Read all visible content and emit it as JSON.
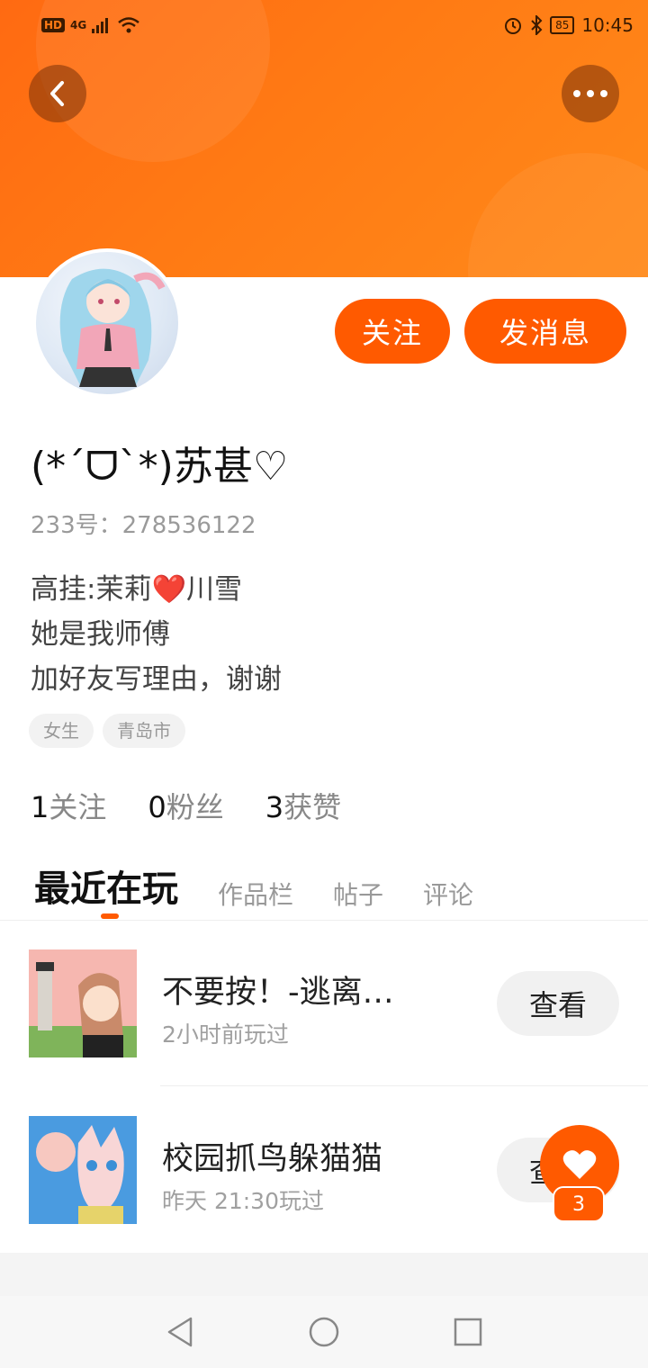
{
  "status_bar": {
    "hd": "HD",
    "network": "4G",
    "battery": "85",
    "time": "10:45"
  },
  "profile": {
    "name": "(*ˊᗜˋ*)苏甚♡",
    "uid": "233号：278536122",
    "bio_lines": [
      "高挂:茉莉❤️川雪",
      "她是我师傅",
      "加好友写理由，谢谢"
    ],
    "tags": [
      "女生",
      "青岛市"
    ]
  },
  "actions": {
    "follow": "关注",
    "message": "发消息"
  },
  "stats": [
    {
      "value": "1",
      "label": "关注"
    },
    {
      "value": "0",
      "label": "粉丝"
    },
    {
      "value": "3",
      "label": "获赞"
    }
  ],
  "tabs": [
    "最近在玩",
    "作品栏",
    "帖子",
    "评论"
  ],
  "games": [
    {
      "title": "不要按！-逃离…",
      "time": "2小时前玩过",
      "button": "查看"
    },
    {
      "title": "校园抓鸟躲猫猫",
      "time": "昨天 21:30玩过",
      "button": "查看"
    }
  ],
  "fab": {
    "count": "3"
  }
}
